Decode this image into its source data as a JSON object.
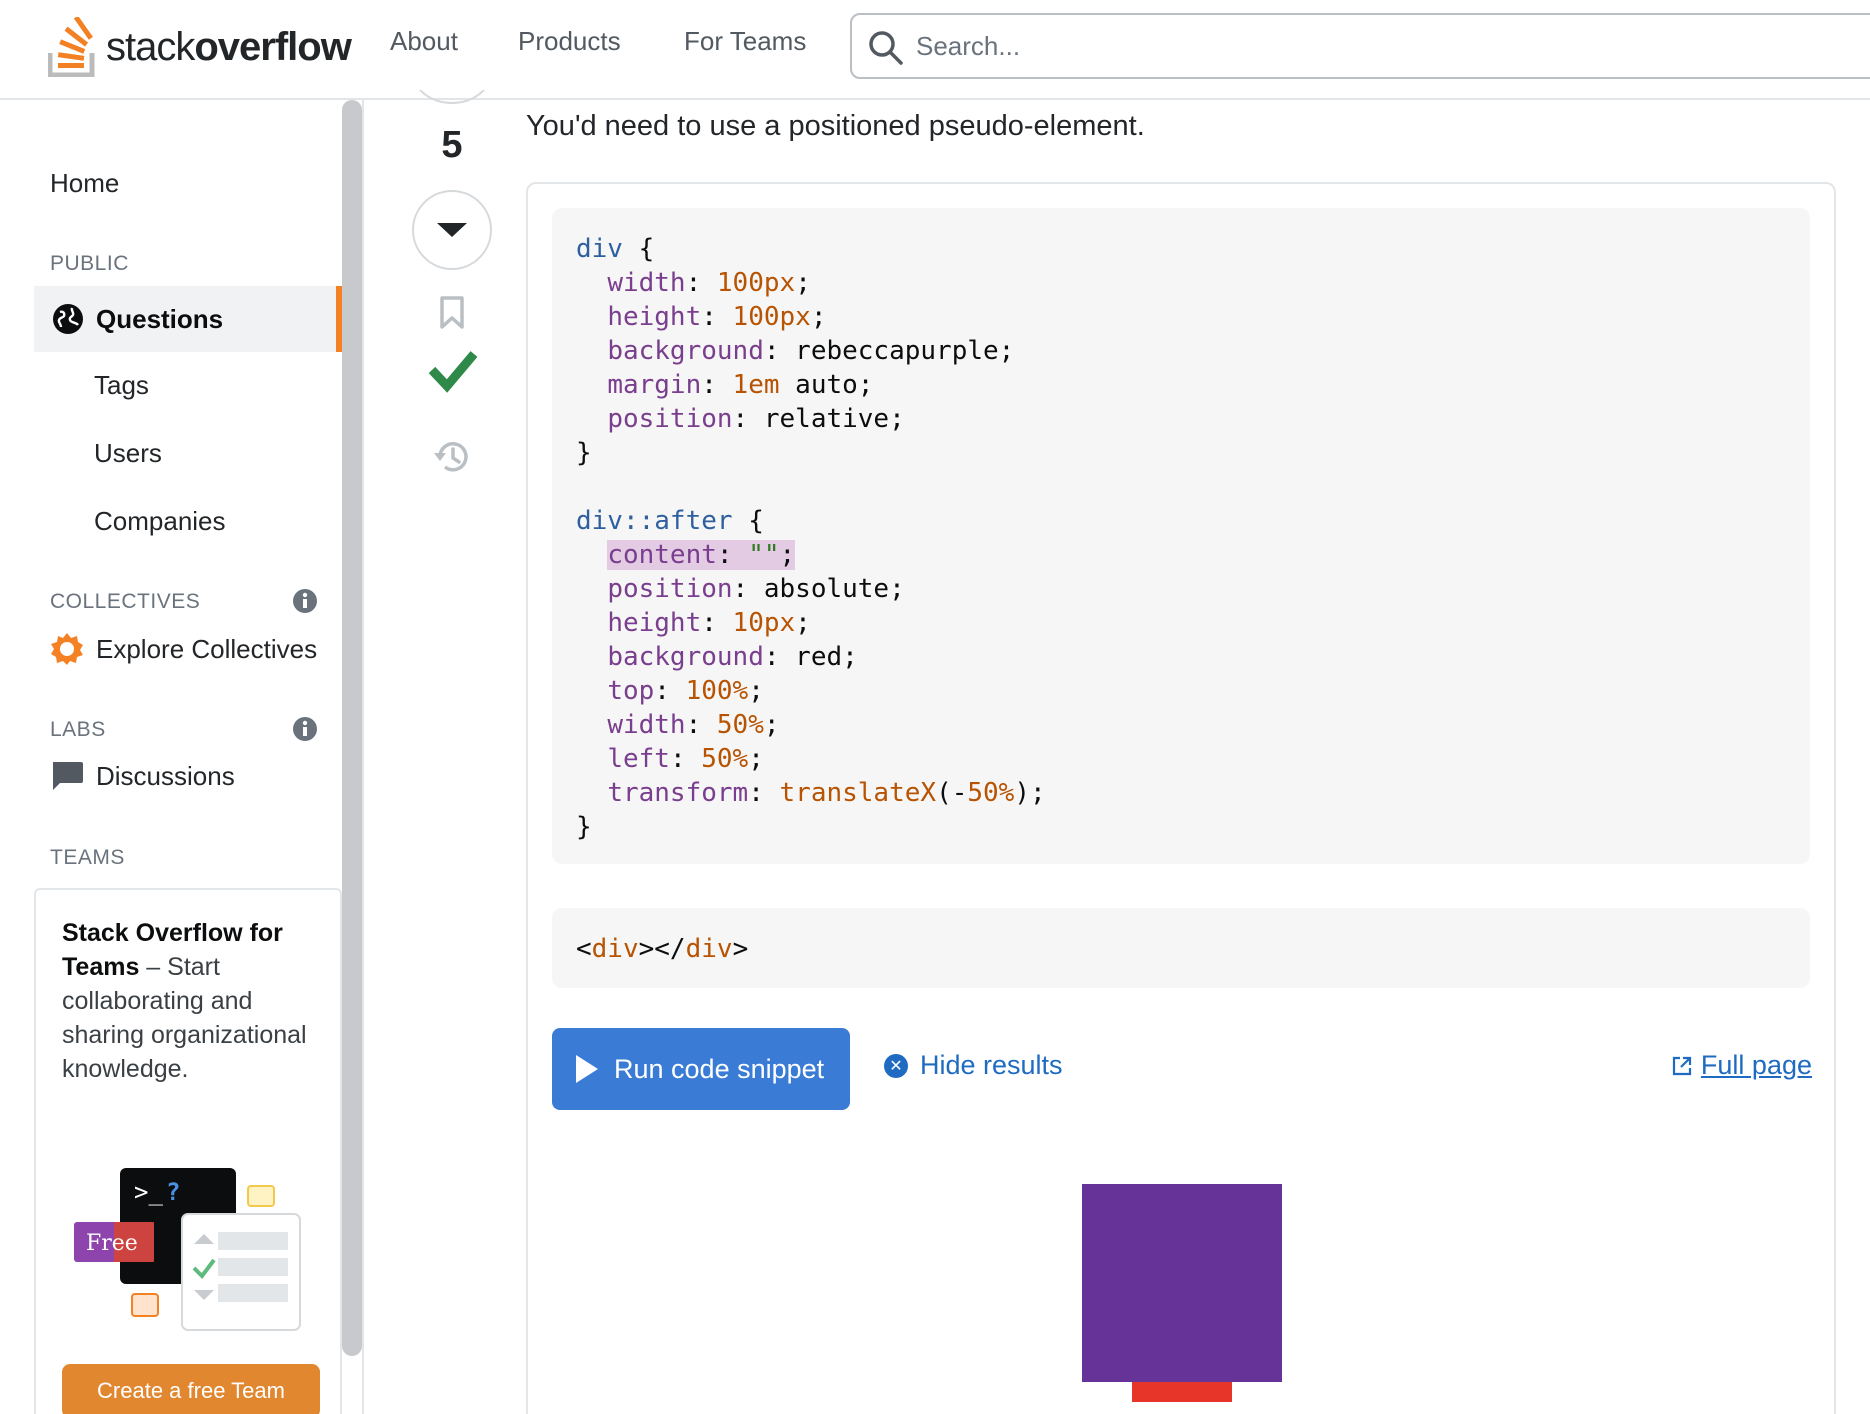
{
  "header": {
    "logo_text_light": "stack",
    "logo_text_bold": "overflow",
    "nav": [
      "About",
      "Products",
      "For Teams"
    ],
    "search_placeholder": "Search..."
  },
  "sidebar": {
    "home": "Home",
    "public_label": "PUBLIC",
    "questions": "Questions",
    "items": [
      "Tags",
      "Users",
      "Companies"
    ],
    "collectives_label": "COLLECTIVES",
    "explore_collectives": "Explore Collectives",
    "labs_label": "LABS",
    "discussions": "Discussions",
    "teams_label": "TEAMS",
    "teams_box": {
      "title": "Stack Overflow for Teams",
      "text": " – Start collaborating and sharing organizational knowledge.",
      "badge": "Free",
      "button": "Create a free Team"
    }
  },
  "vote": {
    "count": "5"
  },
  "answer": {
    "intro": "You'd need to use a positioned pseudo-element.",
    "run_button": "Run code snippet",
    "hide_results": "Hide results",
    "full_page": "Full page"
  },
  "colors": {
    "accent": "#f48225",
    "link": "#1f6bc1",
    "run_button": "#3a7bd5",
    "accepted": "#2f8a4a",
    "result_box": "#663399",
    "result_bar": "#e8352a"
  }
}
